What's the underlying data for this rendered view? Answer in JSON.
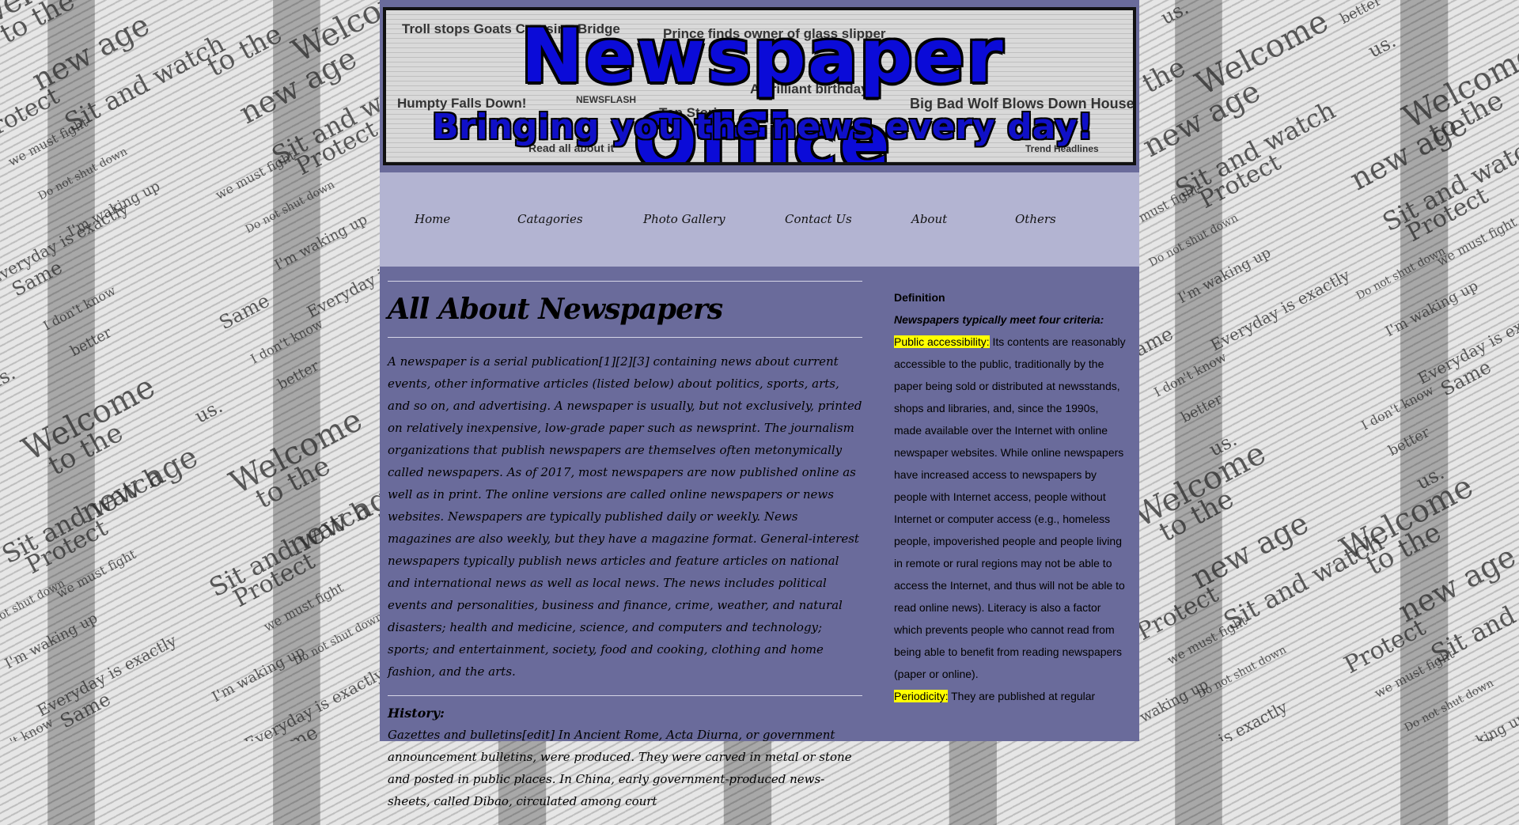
{
  "background": {
    "words": [
      "Welcome",
      "to the",
      "new age",
      "Sit and watch",
      "Protect",
      "we must fight",
      "Do not shut down",
      "I'm waking up",
      "Everyday is exactly",
      "Same",
      "I don't know",
      "better",
      "us."
    ]
  },
  "banner": {
    "title": "Newspaper Office",
    "tagline": "Bringing you the news every day!",
    "headlines": [
      "Troll stops Goats Crossing Bridge",
      "Prince finds owner of glass slipper",
      "Humpty Falls Down!",
      "NEWSFLASH",
      "A brilliant birthday!",
      "Top Stories",
      "Big Bad Wolf Blows Down House",
      "Read all about it",
      "Trend Headlines"
    ]
  },
  "nav": {
    "items": [
      "Home",
      "Catagories",
      "Photo Gallery",
      "Contact Us",
      "About",
      "Others"
    ]
  },
  "main": {
    "title": "All About Newspapers",
    "intro": "A newspaper is a serial publication[1][2][3] containing news about current events, other informative articles (listed below) about politics, sports, arts, and so on, and advertising. A newspaper is usually, but not exclusively, printed on relatively inexpensive, low-grade paper such as newsprint. The journalism organizations that publish newspapers are themselves often metonymically called newspapers. As of 2017, most newspapers are now published online as well as in print. The online versions are called online newspapers or news websites. Newspapers are typically published daily or weekly. News magazines are also weekly, but they have a magazine format. General-interest newspapers typically publish news articles and feature articles on national and international news as well as local news. The news includes political events and personalities, business and finance, crime, weather, and natural disasters; health and medicine, science, and computers and technology; sports; and entertainment, society, food and cooking, clothing and home fashion, and the arts.",
    "history_title": "History:",
    "history_text": "Gazettes and bulletins[edit] In Ancient Rome, Acta Diurna, or government announcement bulletins, were produced. They were carved in metal or stone and posted in public places. In China, early government-produced news-sheets, called Dibao, circulated among court"
  },
  "sidebar": {
    "title": "Definition",
    "subtitle": "Newspapers typically meet four criteria:",
    "item1_label": "Public accessibility:",
    "item1_text": " Its contents are reasonably accessible to the public, traditionally by the paper being sold or distributed at newsstands, shops and libraries, and, since the 1990s, made available over the Internet with online newspaper websites. While online newspapers have increased access to newspapers by people with Internet access, people without Internet or computer access (e.g., homeless people, impoverished people and people living in remote or rural regions may not be able to access the Internet, and thus will not be able to read online news). Literacy is also a factor which prevents people who cannot read from being able to benefit from reading newspapers (paper or online).",
    "item2_label": "Periodicity:",
    "item2_text": " They are published at regular"
  }
}
